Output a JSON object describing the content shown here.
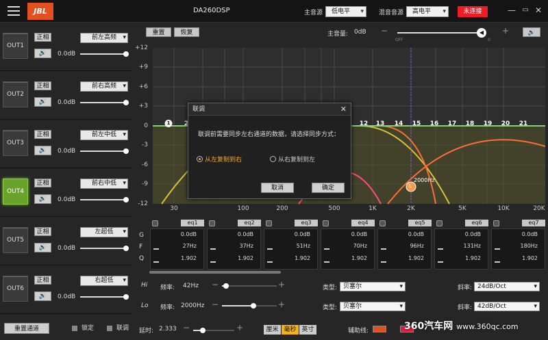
{
  "app": {
    "brand": "JBL",
    "model": "DA260DSP",
    "main_source_label": "主音源",
    "main_source_value": "低电平",
    "mix_source_label": "混音音源",
    "mix_source_value": "高电平",
    "connect_status": "未连接"
  },
  "channels": [
    {
      "out": "OUT1",
      "phase": "正相",
      "assign": "前左高频",
      "gain": "0.0dB",
      "active": false
    },
    {
      "out": "OUT2",
      "phase": "正相",
      "assign": "前右高频",
      "gain": "0.0dB",
      "active": false
    },
    {
      "out": "OUT3",
      "phase": "正相",
      "assign": "前左中低",
      "gain": "0.0dB",
      "active": false
    },
    {
      "out": "OUT4",
      "phase": "正相",
      "assign": "前右中低",
      "gain": "0.0dB",
      "active": true
    },
    {
      "out": "OUT5",
      "phase": "正相",
      "assign": "左超低",
      "gain": "0.0dB",
      "active": false
    },
    {
      "out": "OUT6",
      "phase": "正相",
      "assign": "右超低",
      "gain": "0.0dB",
      "active": false
    }
  ],
  "left_bottom": {
    "reset_channel": "重置通道",
    "lock": "锁定",
    "link": "联调"
  },
  "toolbar": {
    "reset": "重置",
    "restore": "恢复",
    "master_label": "主音量:",
    "master_value": "0dB",
    "off": "OFF",
    "zero": "0"
  },
  "graph": {
    "y_ticks": [
      "+12",
      "+9",
      "+6",
      "+3",
      "0",
      "-3",
      "-6",
      "-9",
      "-12"
    ],
    "x_ticks": [
      "30",
      "100",
      "200",
      "500",
      "1K",
      "2K",
      "5K",
      "10K",
      "20K"
    ],
    "nodes": [
      "1",
      "2",
      "12",
      "13",
      "14",
      "15",
      "16",
      "17",
      "18",
      "19",
      "20",
      "21"
    ],
    "marker_label": "2000Hz",
    "marker_tag": "L"
  },
  "eq": [
    {
      "name": "eq1",
      "gain": "0.0dB",
      "freq": "27Hz",
      "q": "1.902"
    },
    {
      "name": "eq2",
      "gain": "0.0dB",
      "freq": "37Hz",
      "q": "1.902"
    },
    {
      "name": "eq3",
      "gain": "0.0dB",
      "freq": "51Hz",
      "q": "1.902"
    },
    {
      "name": "eq4",
      "gain": "0.0dB",
      "freq": "70Hz",
      "q": "1.902"
    },
    {
      "name": "eq5",
      "gain": "0.0dB",
      "freq": "96Hz",
      "q": "1.902"
    },
    {
      "name": "eq6",
      "gain": "0.0dB",
      "freq": "131Hz",
      "q": "1.902"
    },
    {
      "name": "eq7",
      "gain": "0.0dB",
      "freq": "180Hz",
      "q": "1.902"
    }
  ],
  "eq_labels": {
    "g": "G",
    "f": "F",
    "q": "Q"
  },
  "hilo": {
    "hi_tag": "Hi",
    "lo_tag": "Lo",
    "freq_label": "频率:",
    "hi_freq": "42Hz",
    "lo_freq": "2000Hz",
    "type_label": "类型:",
    "hi_type": "贝塞尔",
    "lo_type": "贝塞尔",
    "slope_label": "斜率:",
    "hi_slope": "24dB/Oct",
    "lo_slope": "42dB/Oct"
  },
  "bottom": {
    "delay_label": "延时:",
    "delay_value": "2.333",
    "units": [
      "厘米",
      "毫秒",
      "英寸"
    ],
    "active_unit": "毫秒",
    "assist_label": "辅助线:"
  },
  "watermark": {
    "brand": "360汽车网",
    "url": "www.360qc.com"
  },
  "dialog": {
    "title": "联调",
    "message": "联调前需要同步左右通道的数据，请选择同步方式：",
    "opt_left": "从左复制到右",
    "opt_right": "从右复制到左",
    "cancel": "取消",
    "ok": "确定"
  }
}
